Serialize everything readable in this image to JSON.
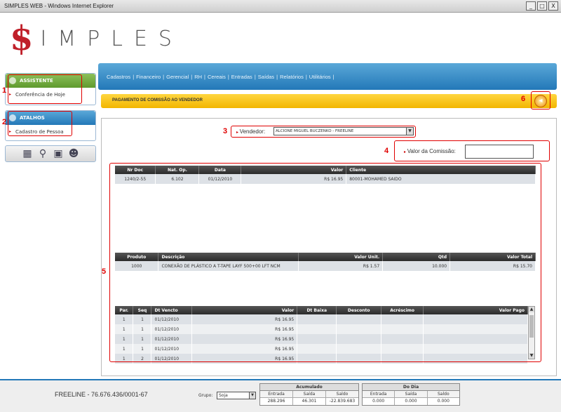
{
  "window": {
    "title": "SIMPLES WEB - Windows Internet Explorer",
    "minimize": "_",
    "maximize": "□",
    "close": "X"
  },
  "logo": {
    "s": "$",
    "rest": "IMPLES"
  },
  "nav": [
    "Cadastros",
    "Financeiro",
    "Gerencial",
    "RH",
    "Cereais",
    "Entradas",
    "Saídas",
    "Relatórios",
    "Utilitários"
  ],
  "nav_sep": "|",
  "sidebar": {
    "assistente": {
      "title": "ASSISTENTE",
      "item": "Conferência de Hoje"
    },
    "atalhos": {
      "title": "ATALHOS",
      "item": "Cadastro de Pessoa"
    }
  },
  "icons": [
    "calculator-icon",
    "search-icon",
    "calendar-icon",
    "user-icon"
  ],
  "icon_glyphs": [
    "▦",
    "⚲",
    "▣",
    "☻"
  ],
  "annotations": [
    "1",
    "2",
    "3",
    "4",
    "5",
    "6"
  ],
  "page_title": "PAGAMENTO DE COMISSÃO AO VENDEDOR",
  "back_glyph": "◂",
  "vendedor": {
    "label": "Vendedor:",
    "value": "ALCIONE MIGUEL BUCZENKO - FREELINE"
  },
  "comissao": {
    "label": "Valor da Comissão:",
    "value": ""
  },
  "docs": {
    "headers": [
      "Nr Doc",
      "Nat. Op.",
      "Data",
      "Valor",
      "Cliente"
    ],
    "rows": [
      [
        "1240/2-55",
        "6.102",
        "01/12/2010",
        "R$ 16.95",
        "80001-MOHAMED SAIDO"
      ]
    ]
  },
  "produtos": {
    "headers": [
      "Produto",
      "Descrição",
      "Valor Unit.",
      "Qtd",
      "Valor Total"
    ],
    "rows": [
      [
        "1000",
        "CONEXÃO DE PLÁSTICO A T-TAPE LAYF 500+00 LFT NCM",
        "R$ 1.57",
        "10.000",
        "R$ 15.70"
      ]
    ]
  },
  "parcelas": {
    "headers": [
      "Par.",
      "Seq",
      "Dt Vencto",
      "Valor",
      "Dt Baixa",
      "Desconto",
      "Acréscimo",
      "Valor Pago"
    ],
    "rows": [
      [
        "1",
        "1",
        "01/12/2010",
        "R$ 16.95",
        "",
        "",
        "",
        ""
      ],
      [
        "1",
        "1",
        "01/12/2010",
        "R$ 16.95",
        "",
        "",
        "",
        ""
      ],
      [
        "1",
        "1",
        "01/12/2010",
        "R$ 16.95",
        "",
        "",
        "",
        ""
      ],
      [
        "1",
        "1",
        "01/12/2010",
        "R$ 16.95",
        "",
        "",
        "",
        ""
      ],
      [
        "1",
        "2",
        "01/12/2010",
        "R$ 16.95",
        "",
        "",
        "",
        ""
      ]
    ]
  },
  "footer": {
    "code": "FREELINE - 76.676.436/0001-67",
    "grupo_label": "Grupo:",
    "grupo_value": "Soja",
    "acumulado": {
      "title": "Acumulado",
      "cols": [
        "Entrada",
        "Saída",
        "Saldo"
      ],
      "values": [
        "288.296",
        "46.301",
        "-22.839.683"
      ]
    },
    "dodia": {
      "title": "Do Dia",
      "cols": [
        "Entrada",
        "Saída",
        "Saldo"
      ],
      "values": [
        "0.000",
        "0.000",
        "0.000"
      ]
    }
  }
}
